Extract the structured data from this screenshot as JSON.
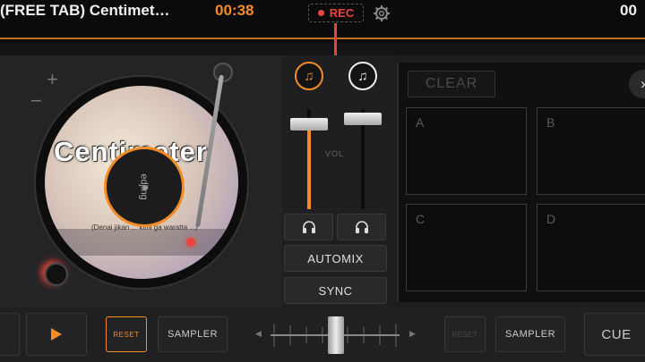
{
  "header": {
    "track_title": "(FREE TAB) Centimet…",
    "elapsed_time": "00:38",
    "rec_label": "REC",
    "remaining_time": "00"
  },
  "deck": {
    "pitch_plus": "+",
    "pitch_minus": "−",
    "vinyl_title": "Centimeter",
    "vinyl_lyric": "(Denai jikan ... kimi ga waratta ...)",
    "label_text": "edjing"
  },
  "mixer": {
    "vol_label": "VOL",
    "left_fader_level": 0.85,
    "right_fader_level": 0.9,
    "automix_label": "AUTOMIX",
    "sync_label": "SYNC"
  },
  "pads": {
    "clear_label": "CLEAR",
    "close_label": "›",
    "items": [
      "A",
      "B",
      "C",
      "D"
    ]
  },
  "bottom": {
    "reset_label": "RESET",
    "sampler_left_label": "SAMPLER",
    "reset_right_label": "RESET",
    "sampler_right_label": "SAMPLER",
    "cue_label": "CUE",
    "crossfader_position": 0.5
  },
  "colors": {
    "accent": "#f28c28",
    "record": "#e8453c"
  }
}
